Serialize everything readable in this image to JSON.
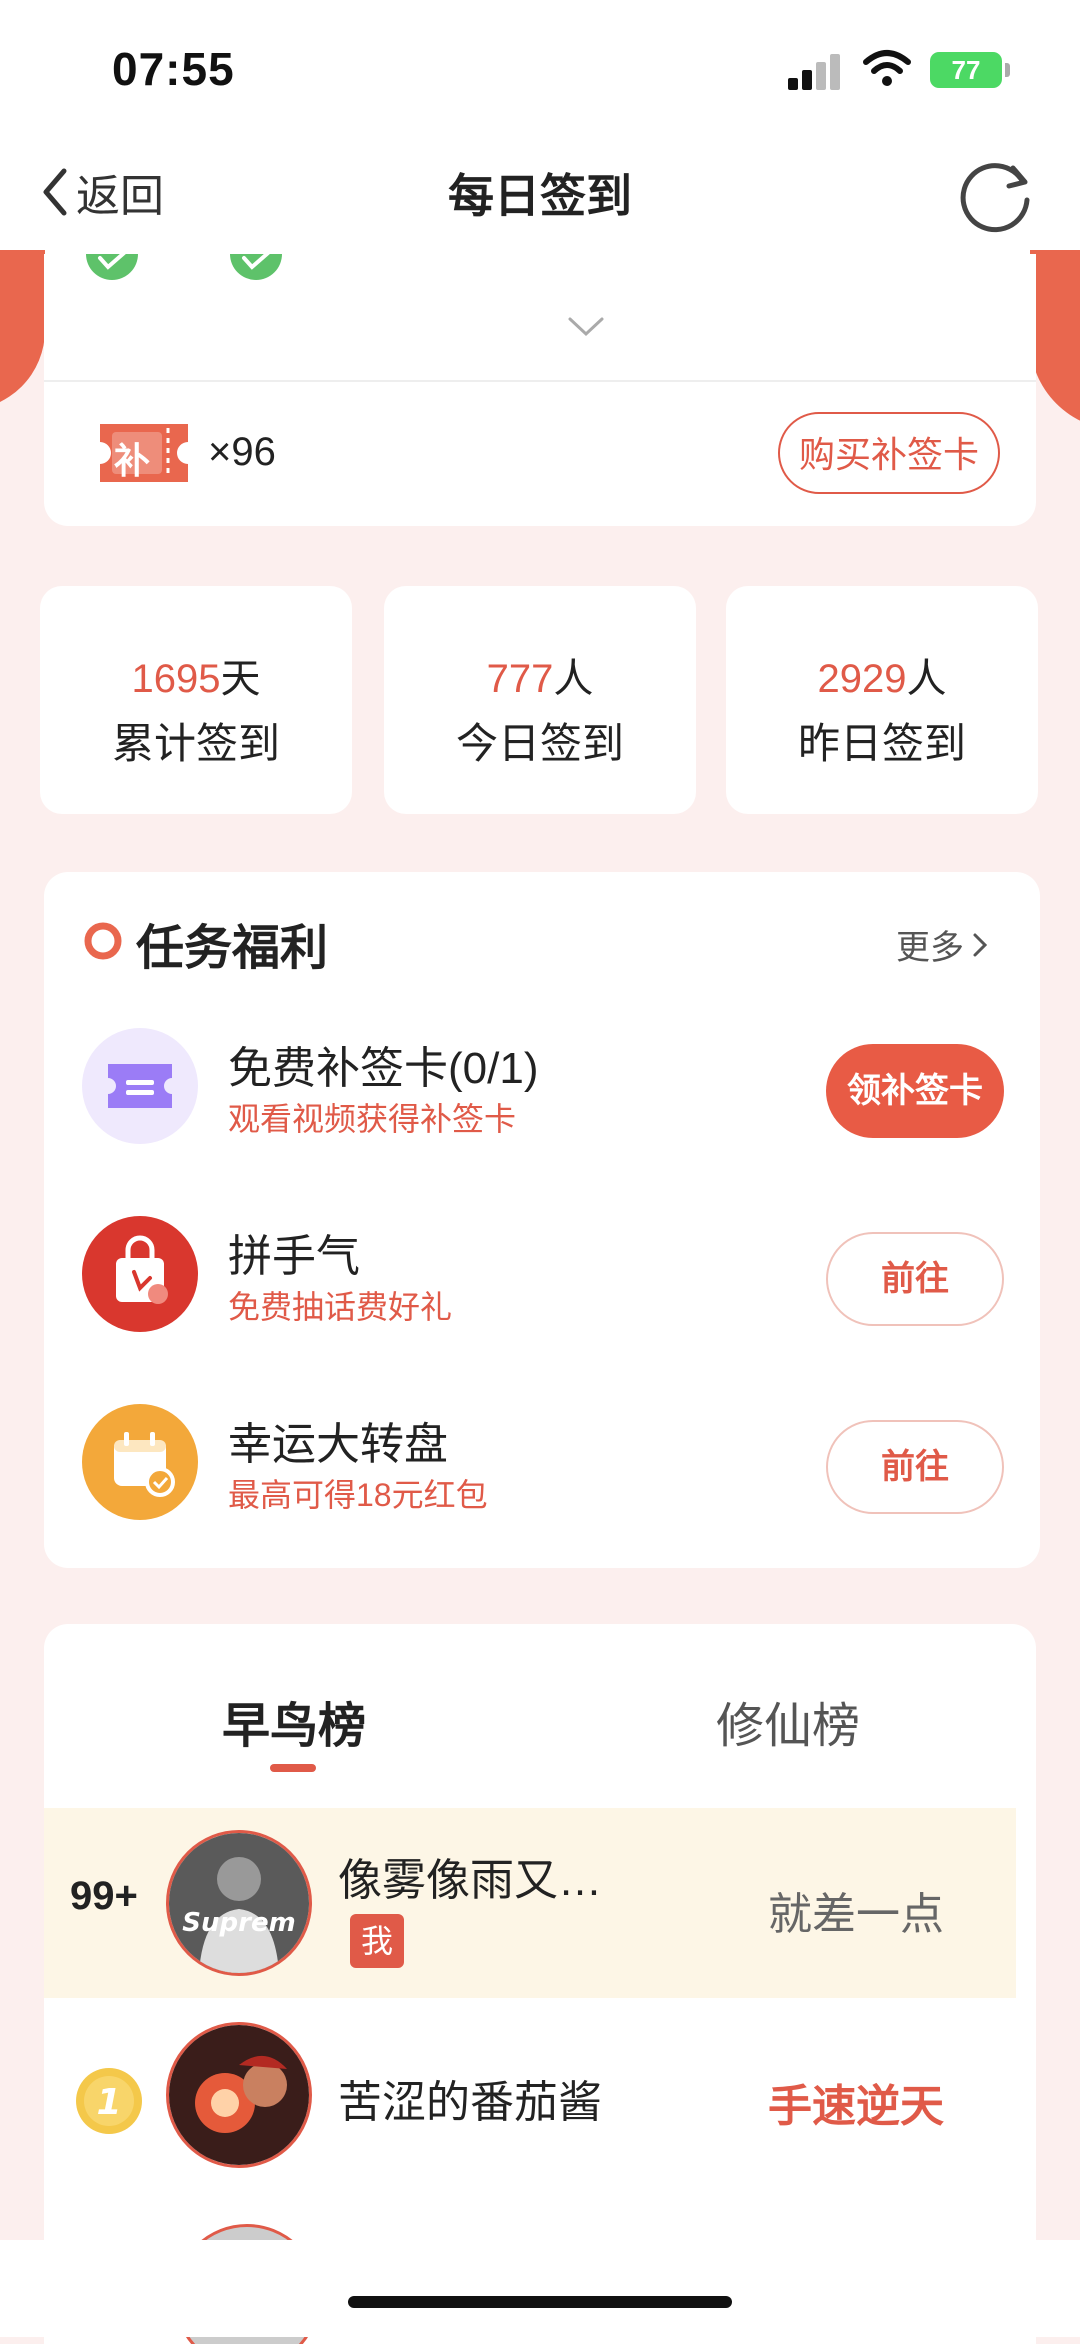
{
  "status_bar": {
    "time": "07:55",
    "battery": "77"
  },
  "nav": {
    "back_label": "返回",
    "title": "每日签到"
  },
  "makeup": {
    "ticket_text": "补",
    "count": "×96",
    "buy_label": "购买补签卡"
  },
  "stats": [
    {
      "num": "1695",
      "unit": "天",
      "label": "累计签到"
    },
    {
      "num": "777",
      "unit": "人",
      "label": "今日签到"
    },
    {
      "num": "2929",
      "unit": "人",
      "label": "昨日签到"
    }
  ],
  "tasks": {
    "title": "任务福利",
    "more": "更多",
    "items": [
      {
        "title": "免费补签卡(0/1)",
        "sub": "观看视频获得补签卡",
        "button": "领补签卡"
      },
      {
        "title": "拼手气",
        "sub": "免费抽话费好礼",
        "button": "前往"
      },
      {
        "title": "幸运大转盘",
        "sub": "最高可得18元红包",
        "button": "前往"
      }
    ]
  },
  "ranking": {
    "tabs": [
      "早鸟榜",
      "修仙榜"
    ],
    "me": {
      "rank": "99+",
      "name": "像雾像雨又…",
      "badge": "我",
      "avatar_text": "Suprem",
      "status": "就差一点"
    },
    "first": {
      "rank": "1",
      "name": "苦涩的番茄酱",
      "status": "手速逆天"
    }
  },
  "colors": {
    "accent": "#e05a48",
    "background": "#fcefee",
    "success": "#4cd964"
  }
}
